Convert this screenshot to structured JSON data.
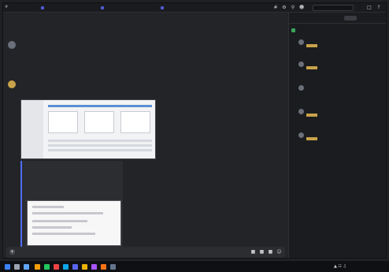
{
  "window": {
    "channel_name": "",
    "pinned": [
      "",
      "",
      ""
    ],
    "search_placeholder": ""
  },
  "messages": [
    {
      "author": "",
      "time": "",
      "text": ""
    },
    {
      "author": "",
      "time": "",
      "text": ""
    },
    {
      "author": "",
      "time": "",
      "text": ""
    },
    {
      "author": "",
      "time": "",
      "text": ""
    }
  ],
  "link_embed": {
    "site": "",
    "title": "",
    "description": ""
  },
  "typing_indicator": "",
  "composer": {
    "placeholder": ""
  },
  "right_panel": {
    "title": "",
    "tabs": [
      "",
      "",
      ""
    ],
    "section": "",
    "items": [
      {
        "author": "",
        "time": "",
        "text": ""
      },
      {
        "author": "",
        "time": "",
        "text": ""
      },
      {
        "author": "",
        "time": "",
        "text": ""
      },
      {
        "author": "",
        "time": "",
        "text": ""
      },
      {
        "author": "",
        "time": "",
        "text": ""
      }
    ]
  },
  "taskbar": {
    "tray_text": "",
    "time": "",
    "date": ""
  },
  "colors": {
    "accent": "#4c6ef5",
    "highlight": "#c9a24a",
    "background": "#232428"
  }
}
